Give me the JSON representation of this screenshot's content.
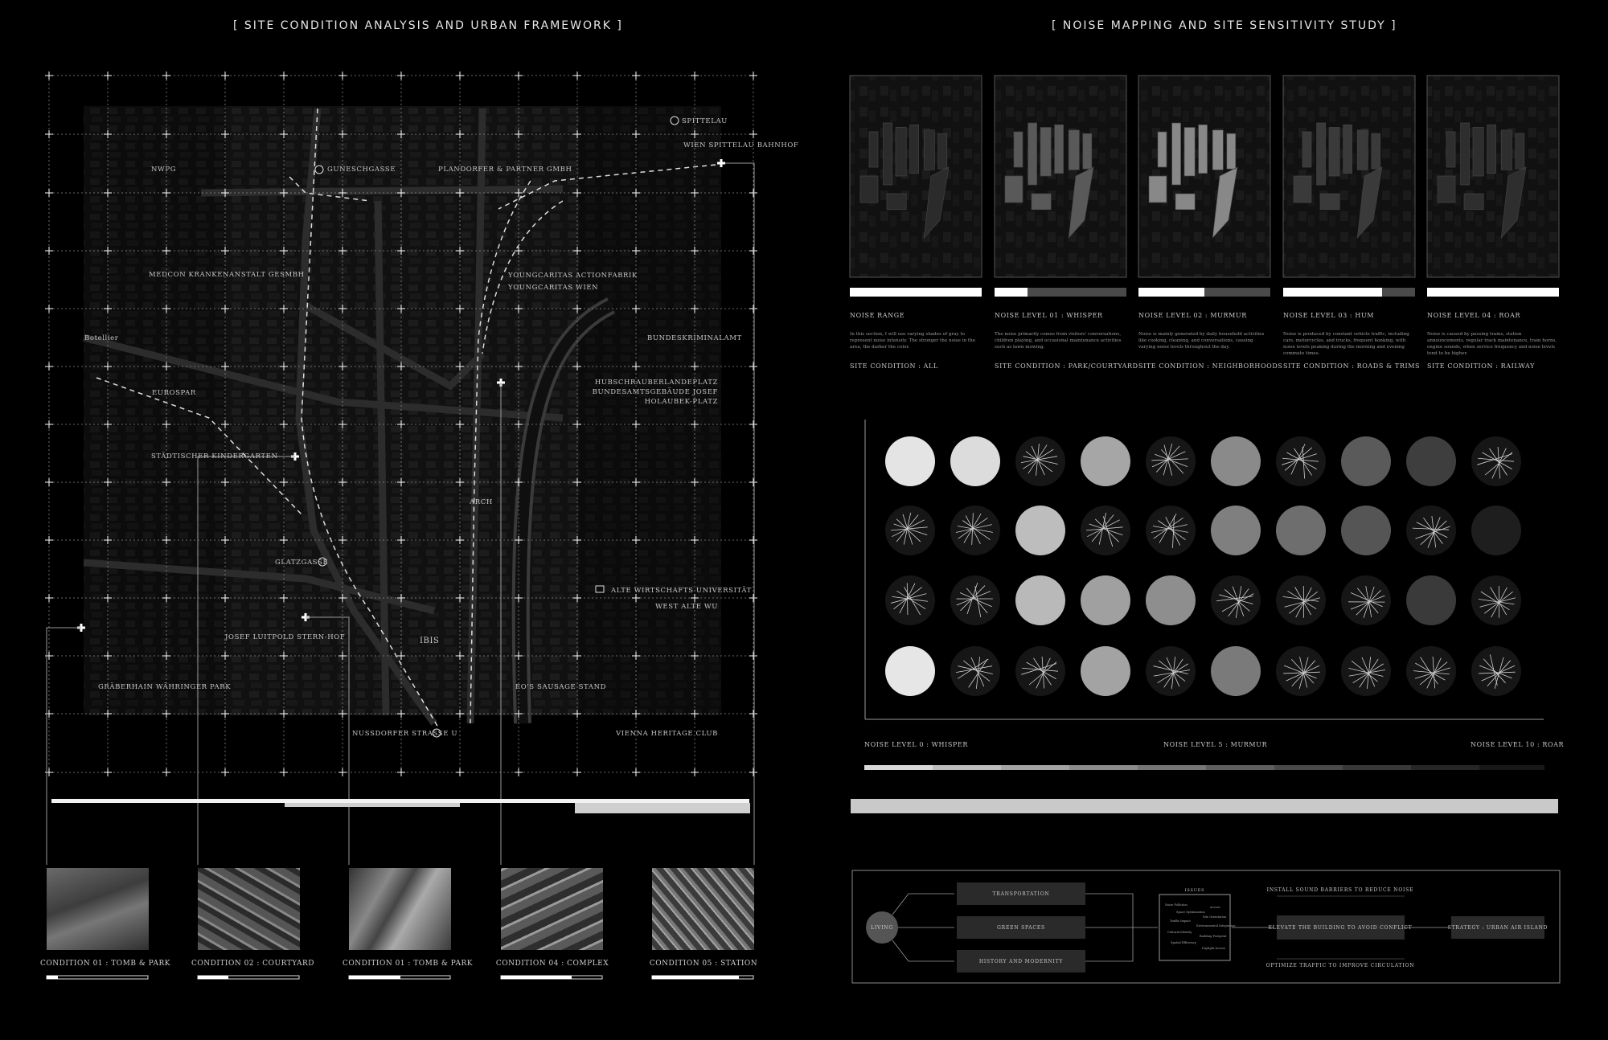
{
  "headings": {
    "left": "[ SITE CONDITION ANALYSIS AND URBAN FRAMEWORK ]",
    "right": "[ NOISE MAPPING AND SITE SENSITIVITY STUDY ]"
  },
  "map_labels": {
    "nwpg": "NWPG",
    "guneschgasse": "GUNESCHGASSE",
    "plandorfer": "PLANDORFER & PARTNER GMBH",
    "spittelau": "SPITTELAU",
    "wien_spittelau": "WIEN SPITTELAU BAHNHOF",
    "medcon": "MEDCON KRANKENANSTALT GESMBH",
    "youngcaritas_action": "YOUNGCARITAS ACTIONFABRIK",
    "youngcaritas_wien": "YOUNGCARITAS WIEN",
    "botellier": "Botellier",
    "bundeskriminalamt": "BUNDESKRIMINALAMT",
    "eurospar": "EUROSPAR",
    "hubschrauber_1": "HUBSCHRAUBERLANDEPLATZ",
    "hubschrauber_2": "BUNDESAMTSGEBÄUDE JOSEF",
    "hubschrauber_3": "HOLAUBEK-PLATZ",
    "kindergarten": "STÄDTISCHER KINDERGARTEN",
    "arch": "ARCH",
    "glatzgasse": "GLATZGASSE",
    "alte_wu": "ALTE WIRTSCHAFTS UNIVERSITÄT",
    "west_alte_wu": "WEST ALTE WU",
    "josef": "JOSEF LUITPOLD STERN-HOF",
    "ibis": "IBIS",
    "graeberhain": "GRÄBERHAIN WÄHRINGER PARK",
    "eos": "EO'S SAUSAGE STAND",
    "nussdorfer": "NUSSDORFER STRASSE U",
    "vienna_heritage": "VIENNA HERITAGE CLUB"
  },
  "conditions": [
    {
      "caption": "CONDITION 01 : TOMB & PARK"
    },
    {
      "caption": "CONDITION 02 : COURTYARD"
    },
    {
      "caption": "CONDITION 01 : TOMB & PARK"
    },
    {
      "caption": "CONDITION 04 : COMPLEX"
    },
    {
      "caption": "CONDITION 05 : STATION"
    }
  ],
  "noise_levels": [
    {
      "title": "NOISE RANGE",
      "desc": "In this section, I will use varying shades of gray to represent noise intensity. The stronger the noise in the area, the darker the color.",
      "site": "SITE CONDITION : ALL",
      "bar_fill": 1.0
    },
    {
      "title": "NOISE LEVEL 01 : WHISPER",
      "desc": "The noise primarily comes from visitors' conversations, children playing, and occasional maintenance activities such as lawn mowing.",
      "site": "SITE CONDITION : PARK/COURTYARD",
      "bar_fill": 0.25
    },
    {
      "title": "NOISE LEVEL 02 : MURMUR",
      "desc": "Noise is mainly generated by daily household activities like cooking, cleaning, and conversations, causing varying noise levels throughout the day.",
      "site": "SITE CONDITION : NEIGHBORHOODS",
      "bar_fill": 0.5
    },
    {
      "title": "NOISE LEVEL 03 : HUM",
      "desc": "Noise is produced by constant vehicle traffic, including cars, motorcycles, and trucks, frequent honking, with noise levels peaking during the morning and evening commute times.",
      "site": "SITE CONDITION : ROADS & TRIMS",
      "bar_fill": 0.75
    },
    {
      "title": "NOISE LEVEL 04 : ROAR",
      "desc": "Noise is caused by passing trains, station announcements, regular track maintenance, train horns, engine sounds, when service frequency and noise levels tend to be higher.",
      "site": "SITE CONDITION : RAILWAY",
      "bar_fill": 1.0
    }
  ],
  "scale": {
    "left": "NOISE LEVEL 0 : WHISPER",
    "mid": "NOISE LEVEL 5 : MURMUR",
    "right": "NOISE LEVEL 10 : ROAR"
  },
  "flow": {
    "living": "LIVING",
    "transportation": "TRANSPORTATION",
    "green_spaces": "GREEN SPACES",
    "history": "HISTORY AND MODERNITY",
    "issues": "ISSUES",
    "issues_list": [
      "Noise Pollution",
      "Access",
      "Space Optimization",
      "Site Orientation",
      "Traffic Impact",
      "Environmental Integration",
      "Cultural Identity",
      "Building Footprint",
      "Spatial Efficiency",
      "Daylight Access"
    ],
    "install_barriers": "INSTALL SOUND BARRIERS TO REDUCE NOISE",
    "elevate": "ELEVATE THE BUILDING TO AVOID CONFLICT",
    "optimize": "OPTIMIZE TRAFFIC TO IMPROVE CIRCULATION",
    "strategy": "STRATEGY : URBAN AIR ISLAND"
  },
  "colors": {
    "background": "#000000",
    "text": "#dddddd",
    "line": "#8a8a8a"
  }
}
